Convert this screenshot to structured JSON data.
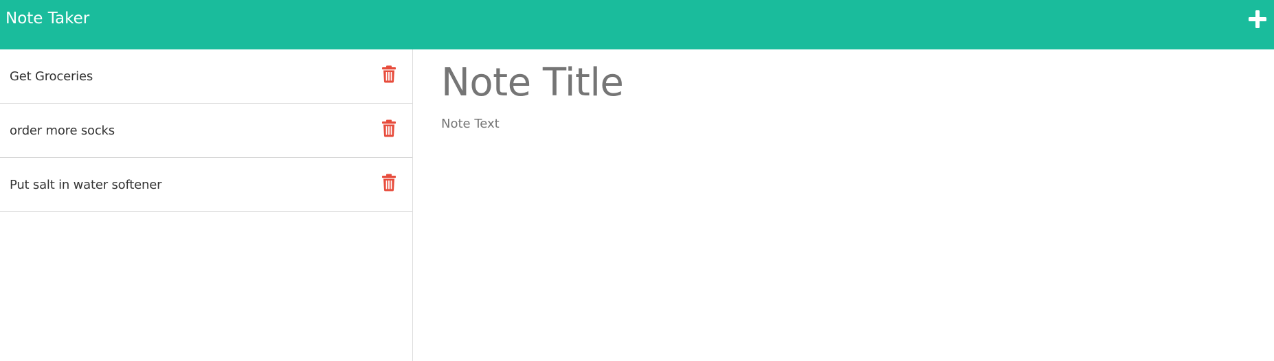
{
  "app": {
    "title": "Note Taker",
    "accent_color": "#1abc9c",
    "delete_color": "#e74c3c"
  },
  "header": {
    "add_icon": "plus-icon"
  },
  "sidebar": {
    "notes": [
      {
        "title": "Get Groceries",
        "delete_icon": "trash-icon"
      },
      {
        "title": "order more socks",
        "delete_icon": "trash-icon"
      },
      {
        "title": "Put salt in water softener",
        "delete_icon": "trash-icon"
      }
    ]
  },
  "editor": {
    "title_placeholder": "Note Title",
    "text_placeholder": "Note Text"
  }
}
